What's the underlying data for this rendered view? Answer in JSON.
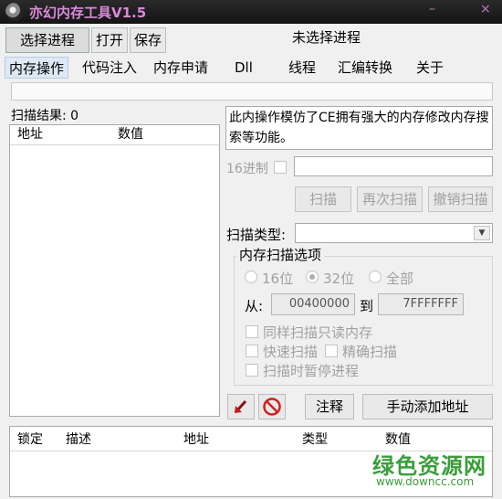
{
  "app": {
    "title": "亦幻内存工具V1.5",
    "minimize_glyph": "–",
    "close_glyph": "×"
  },
  "toolbar": {
    "select_process_label": "选择进程",
    "open_label": "打开",
    "save_label": "保存",
    "status_text": "未选择进程"
  },
  "menu": {
    "items": [
      {
        "label": "内存操作",
        "active": true
      },
      {
        "label": "代码注入",
        "active": false
      },
      {
        "label": "内存申请",
        "active": false
      },
      {
        "label": "Dll",
        "active": false
      },
      {
        "label": "线程",
        "active": false
      },
      {
        "label": "汇编转换",
        "active": false
      },
      {
        "label": "关于",
        "active": false
      }
    ]
  },
  "scan_results": {
    "label": "扫描结果: 0",
    "columns": [
      "地址",
      "数值"
    ]
  },
  "description": "此内操作模仿了CE拥有强大的内存修改内存搜索等功能。",
  "hex": {
    "label": "16进制",
    "checked": false
  },
  "scan_buttons": {
    "scan": "扫描",
    "rescan": "再次扫描",
    "undo": "撤销扫描"
  },
  "scan_type": {
    "label": "扫描类型:",
    "value": ""
  },
  "options": {
    "group_title": "内存扫描选项",
    "radios": [
      {
        "label": "16位",
        "selected": false
      },
      {
        "label": "32位",
        "selected": true
      },
      {
        "label": "全部",
        "selected": false
      }
    ],
    "from_label": "从:",
    "from_value": "00400000",
    "to_label": "到",
    "to_value": "7FFFFFFF",
    "checkboxes": [
      {
        "label": "同样扫描只读内存",
        "checked": false
      },
      {
        "label": "快速扫描",
        "checked": false
      },
      {
        "label": "精确扫描",
        "checked": false
      },
      {
        "label": "扫描时暂停进程",
        "checked": false
      }
    ]
  },
  "actions": {
    "arrow_icon": "red-arrow-down-left",
    "stop_icon": "red-prohibit",
    "comment": "注释",
    "add_address": "手动添加地址"
  },
  "address_table": {
    "columns": [
      "锁定",
      "描述",
      "地址",
      "类型",
      "数值"
    ]
  },
  "watermark": {
    "text": "绿色资源网",
    "url": "www.downcc.com"
  }
}
